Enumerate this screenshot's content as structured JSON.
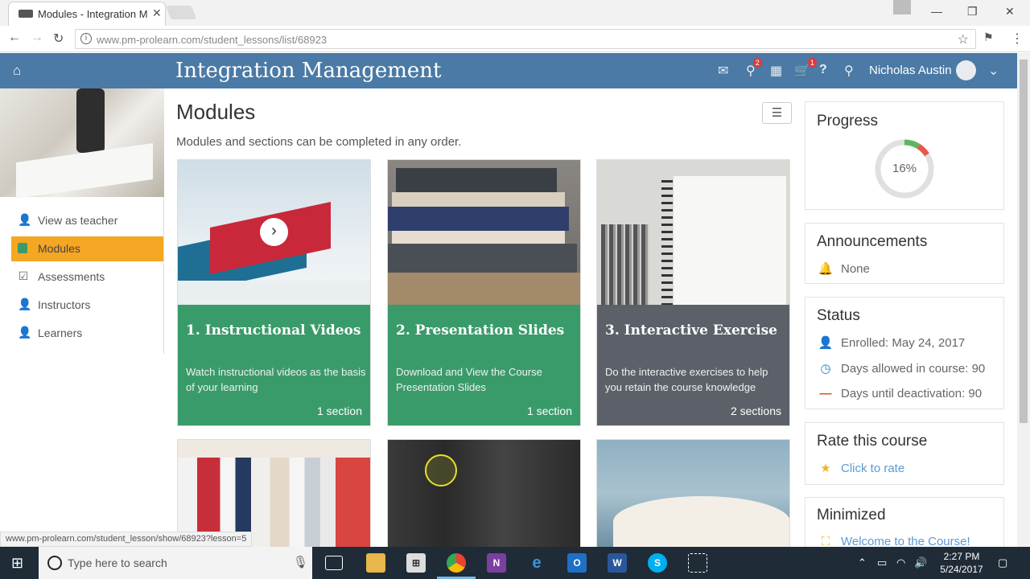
{
  "browser": {
    "tab_title": "Modules - Integration M",
    "url_domain": "www.pm-prolearn.com",
    "url_path": "/student_lessons/list/68923",
    "status_url": "www.pm-prolearn.com/student_lesson/show/68923?lesson=5"
  },
  "header": {
    "course_title": "Integration Management",
    "user_name": "Nicholas Austin",
    "notifications_badge": "2",
    "cart_badge": "1"
  },
  "sidebar": {
    "items": [
      {
        "label": "View as teacher",
        "icon": "person-icon"
      },
      {
        "label": "Modules",
        "icon": "modules-icon"
      },
      {
        "label": "Assessments",
        "icon": "checkbox-icon"
      },
      {
        "label": "Instructors",
        "icon": "person-icon"
      },
      {
        "label": "Learners",
        "icon": "person-icon"
      }
    ],
    "active_index": 1
  },
  "main": {
    "title": "Modules",
    "subtitle": "Modules and sections can be completed in any order."
  },
  "modules": [
    {
      "title": "1. Instructional Videos",
      "description": "Watch instructional videos as the basis of your learning",
      "sections": "1 section",
      "color": "#3a9b6a"
    },
    {
      "title": "2. Presentation Slides",
      "description": "Download and View the Course Presentation Slides",
      "sections": "1 section",
      "color": "#3a9b6a"
    },
    {
      "title": "3. Interactive Exercise",
      "description": "Do the interactive exercises to help you retain the course knowledge",
      "sections": "2 sections",
      "color": "#5c6169"
    }
  ],
  "progress": {
    "heading": "Progress",
    "value_label": "16%",
    "value": 0.16
  },
  "announcements": {
    "heading": "Announcements",
    "value": "None"
  },
  "status": {
    "heading": "Status",
    "enrolled": "Enrolled: May 24, 2017",
    "days_allowed": "Days allowed in course: 90",
    "days_until": "Days until deactivation: 90"
  },
  "rate": {
    "heading": "Rate this course",
    "link": "Click to rate"
  },
  "minimized": {
    "heading": "Minimized",
    "item": "Welcome to the Course!"
  },
  "taskbar": {
    "search_placeholder": "Type here to search",
    "time": "2:27 PM",
    "date": "5/24/2017"
  },
  "colors": {
    "header_blue": "#4a7aa5",
    "active_orange": "#f5a623",
    "card_green": "#3a9b6a",
    "card_gray": "#5c6169",
    "link_blue": "#5b9bd5"
  }
}
